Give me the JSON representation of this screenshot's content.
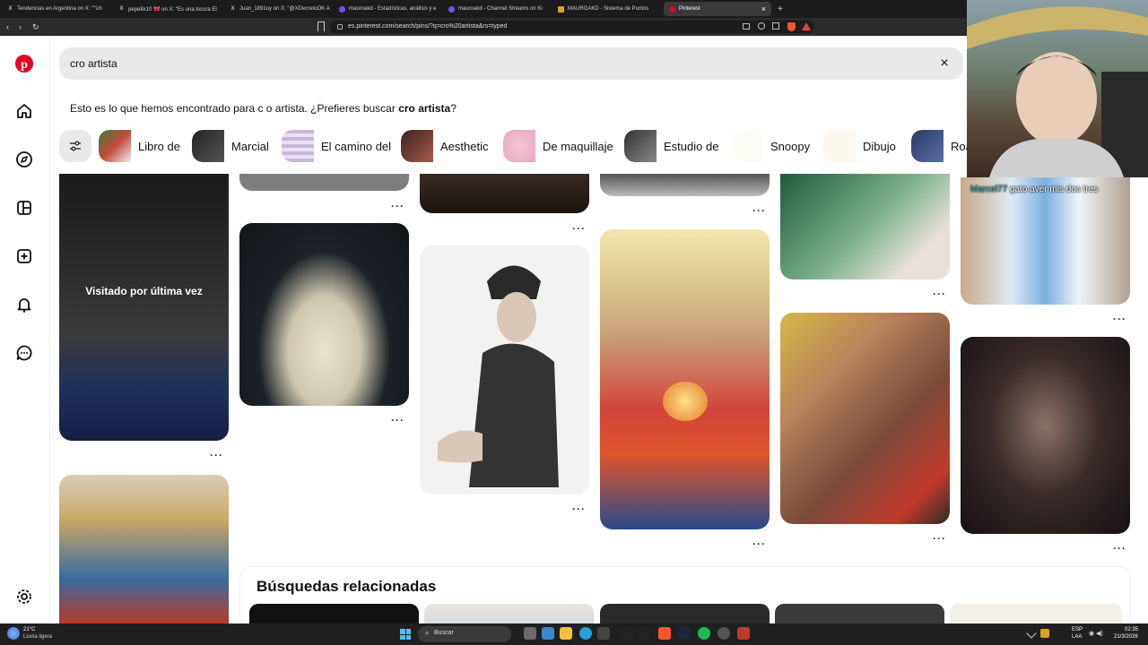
{
  "browser": {
    "tabs": [
      {
        "label": "Tendencias en Argentina on X: \"\"Un",
        "icon": "x-icon"
      },
      {
        "label": "pepe8x10 🎀 on X: \"Es una locura El",
        "icon": "x-icon"
      },
      {
        "label": "Juan_1891uy on X: \"@XDecretoOK A",
        "icon": "x-icon"
      },
      {
        "label": "mauroakd - Estadísticas, análisis y e",
        "icon": "kick-icon"
      },
      {
        "label": "mauroakd - Channel Streams on Ki",
        "icon": "kick-icon"
      },
      {
        "label": "MAUROAKD - Sistema de Puntos",
        "icon": "points-icon"
      },
      {
        "label": "Pinterest",
        "icon": "pinterest-icon"
      }
    ],
    "url": "es.pinterest.com/search/pins/?q=cro%20artista&rs=typed",
    "new_tab": "+",
    "close_tab": "×"
  },
  "sidebar": {
    "items": [
      {
        "name": "pinterest-logo-icon"
      },
      {
        "name": "home-icon"
      },
      {
        "name": "explore-icon"
      },
      {
        "name": "boards-icon"
      },
      {
        "name": "create-icon"
      },
      {
        "name": "notifications-icon"
      },
      {
        "name": "messages-icon"
      },
      {
        "name": "settings-icon"
      }
    ]
  },
  "search": {
    "query": "cro artista",
    "clear": "×"
  },
  "suggestion": {
    "prefix": "Esto es lo que hemos encontrado para c o artista. ¿Prefieres buscar ",
    "term": "cro artista",
    "suffix": "?"
  },
  "chips": [
    {
      "label": "Libro de",
      "color": "#dfe3ff"
    },
    {
      "label": "Marcial",
      "color": "#a9b4ff"
    },
    {
      "label": "El camino del",
      "color": "#f5dcf5"
    },
    {
      "label": "Aesthetic",
      "color": "#f8d3d8"
    },
    {
      "label": "De maquillaje",
      "color": "#f8dfd3"
    },
    {
      "label": "Estudio de",
      "color": "#dce6f5"
    },
    {
      "label": "Snoopy",
      "color": "#b7efb8"
    },
    {
      "label": "Dibujo",
      "color": "#dfe3ff"
    },
    {
      "label": "Roa",
      "color": "#a9b4ff"
    }
  ],
  "pins": {
    "visited_label": "Visitado por última vez",
    "more": "···"
  },
  "related": {
    "title": "Búsquedas relacionadas"
  },
  "stream": {
    "chat_user": "Marcel77",
    "chat_message": "gato aver mis dos tres"
  },
  "taskbar": {
    "weather_temp": "21°C",
    "weather_desc": "Lluvia ligera",
    "search_placeholder": "Buscar",
    "lang": "ESP",
    "lang_sub": "LAA",
    "time": "02:35",
    "date": "21/3/2026"
  }
}
